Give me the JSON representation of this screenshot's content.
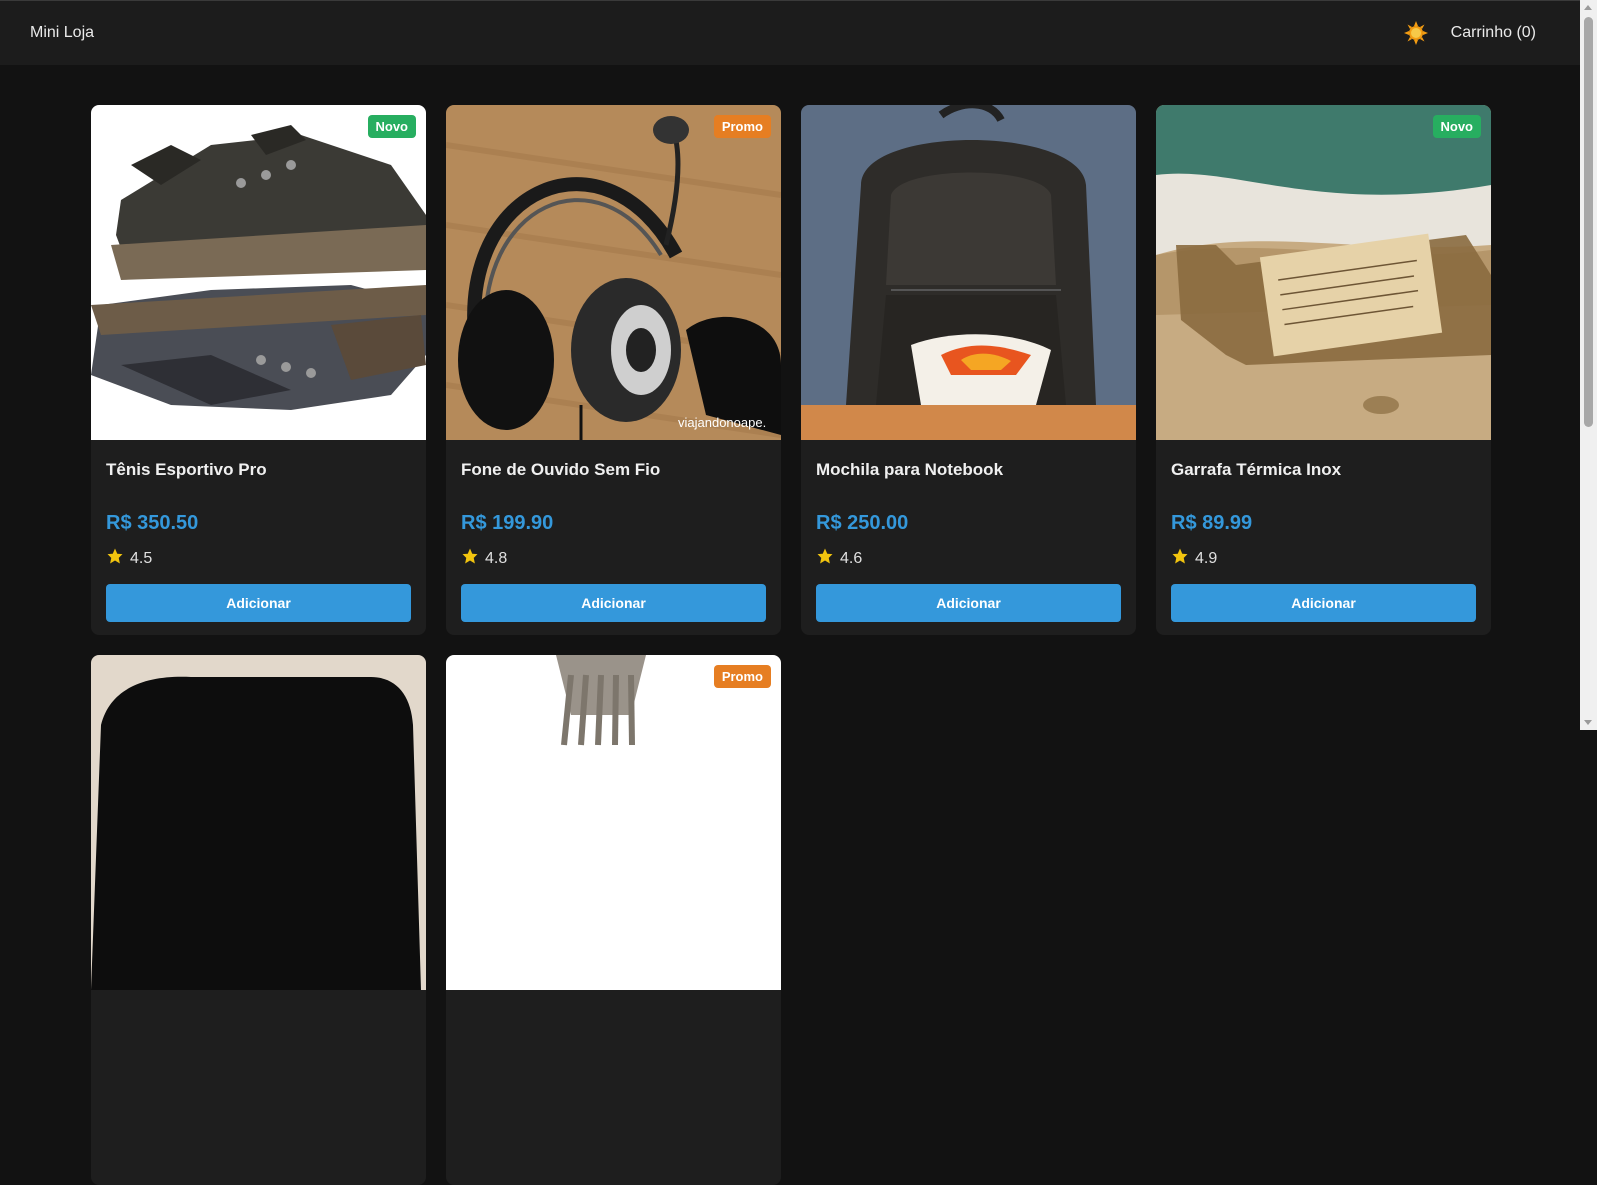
{
  "header": {
    "brand": "Mini Loja",
    "cart_label": "Carrinho (0)",
    "theme_icon": "sun-icon"
  },
  "colors": {
    "accent": "#3498db",
    "badge_novo": "#27ae60",
    "badge_promo": "#e67e22",
    "background": "#121212",
    "card": "#1e1e1e"
  },
  "products": [
    {
      "name": "Tênis Esportivo Pro",
      "price": "R$ 350.50",
      "rating": "4.5",
      "badge": "Novo",
      "button": "Adicionar"
    },
    {
      "name": "Fone de Ouvido Sem Fio",
      "price": "R$ 199.90",
      "rating": "4.8",
      "badge": "Promo",
      "button": "Adicionar",
      "watermark": "viajandonoape."
    },
    {
      "name": "Mochila para Notebook",
      "price": "R$ 250.00",
      "rating": "4.6",
      "badge": "",
      "button": "Adicionar"
    },
    {
      "name": "Garrafa Térmica Inox",
      "price": "R$ 89.99",
      "rating": "4.9",
      "badge": "Novo",
      "button": "Adicionar"
    },
    {
      "name": "",
      "price": "",
      "rating": "",
      "badge": "",
      "button": ""
    },
    {
      "name": "",
      "price": "",
      "rating": "",
      "badge": "Promo",
      "button": ""
    }
  ]
}
